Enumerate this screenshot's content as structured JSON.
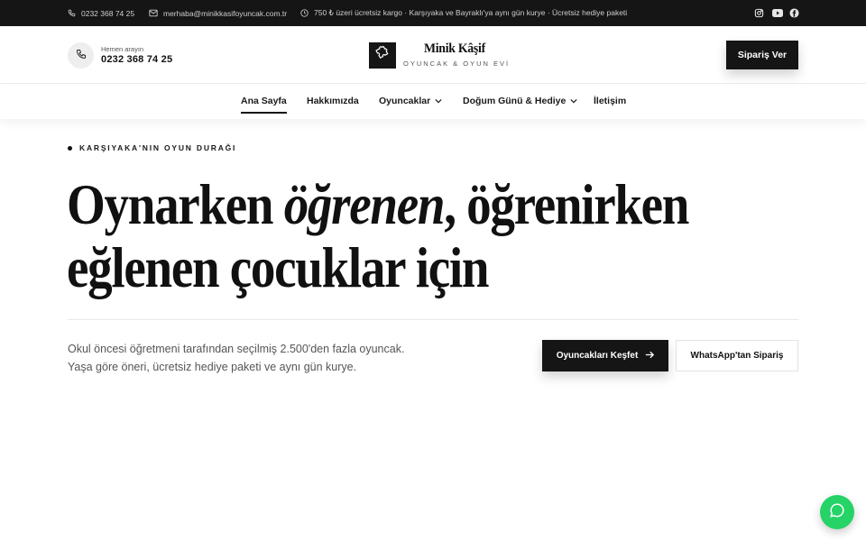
{
  "topbar": {
    "phone": "0232 368 74 25",
    "email": "merhaba@minikkasifoyuncak.com.tr",
    "shipping_note": "750 ₺ üzeri ücretsiz kargo · Karşıyaka ve Bayraklı'ya aynı gün kurye · Ücretsiz hediye paketi",
    "social_icons": [
      "instagram-icon",
      "youtube-icon",
      "facebook-icon"
    ]
  },
  "header": {
    "call_label": "Hemen arayın",
    "call_number": "0232 368 74 25",
    "logo_title": "Minik Kâşif",
    "logo_subtitle": "OYUNCAK & OYUN EVİ",
    "order_button": "Sipariş Ver"
  },
  "nav": {
    "items": [
      {
        "label": "Ana Sayfa",
        "active": true
      },
      {
        "label": "Hakkımızda"
      },
      {
        "label": "Oyuncaklar",
        "dropdown": true
      },
      {
        "label": "Doğum Günü & Hediye",
        "dropdown": true
      },
      {
        "label": "İletişim"
      }
    ]
  },
  "hero": {
    "eyebrow": "KARŞIYAKA'NIN OYUN DURAĞI",
    "headline_part1": "Oynarken ",
    "headline_em": "öğrenen",
    "headline_part2": ", öğrenirken",
    "headline_line2": "eğlenen çocuklar için",
    "lead": "Okul öncesi öğretmeni tarafından seçilmiş 2.500'den fazla oyuncak. Yaşa göre öneri, ücretsiz hediye paketi ve aynı gün kurye.",
    "primary_button": "Oyuncakları Keşfet",
    "secondary_button": "WhatsApp'tan Sipariş"
  },
  "colors": {
    "dark": "#151515",
    "whatsapp": "#25d366"
  }
}
